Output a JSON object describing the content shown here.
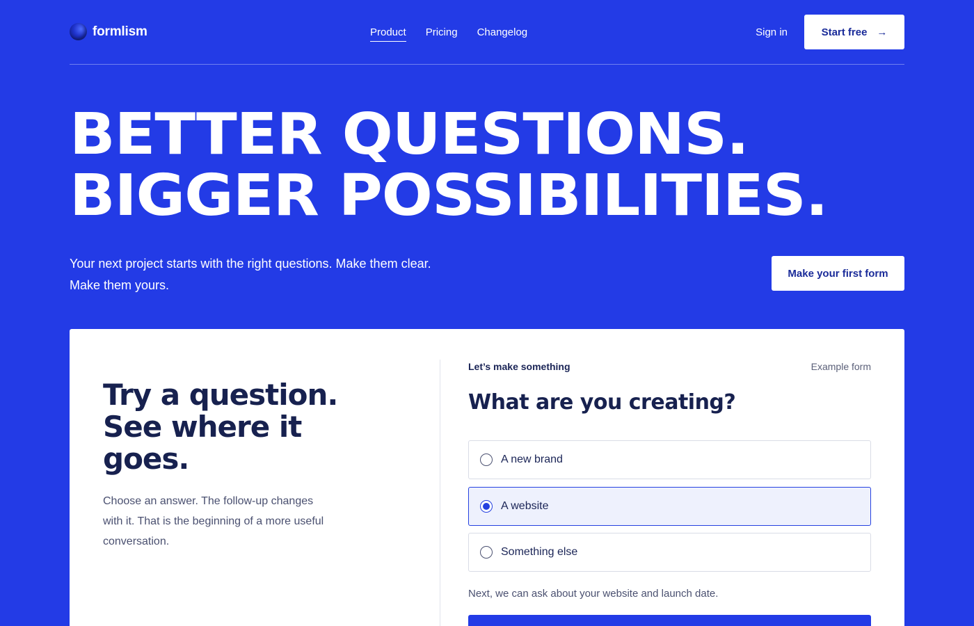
{
  "brand": {
    "name": "formlism"
  },
  "nav": {
    "links": [
      {
        "label": "Product",
        "active": true
      },
      {
        "label": "Pricing",
        "active": false
      },
      {
        "label": "Changelog",
        "active": false
      }
    ],
    "signin_label": "Sign in",
    "start_label": "Start free",
    "start_icon": "arrow-right-icon"
  },
  "hero": {
    "title_line1": "BETTER QUESTIONS.",
    "title_line2": "BIGGER POSSIBILITIES.",
    "subtitle_line1": "Your next project starts with the right questions. Make them clear.",
    "subtitle_line2": "Make them yours.",
    "cta_label": "Make your first form"
  },
  "card": {
    "title_line1": "Try a question.",
    "title_line2": "See where it",
    "title_line3": "goes.",
    "description": "Choose an answer. The follow-up changes with it. That is the beginning of a more useful conversation.",
    "form": {
      "eyebrow": "Let’s make something",
      "tag": "Example form",
      "question": "What are you creating?",
      "options": [
        {
          "label": "A new brand",
          "selected": false
        },
        {
          "label": "A website",
          "selected": true
        },
        {
          "label": "Something else",
          "selected": false
        }
      ],
      "hint": "Next, we can ask about your website and launch date."
    }
  },
  "colors": {
    "background": "#233be6",
    "card": "#ffffff",
    "heading_dark": "#17214f",
    "accent": "#2440e0"
  }
}
